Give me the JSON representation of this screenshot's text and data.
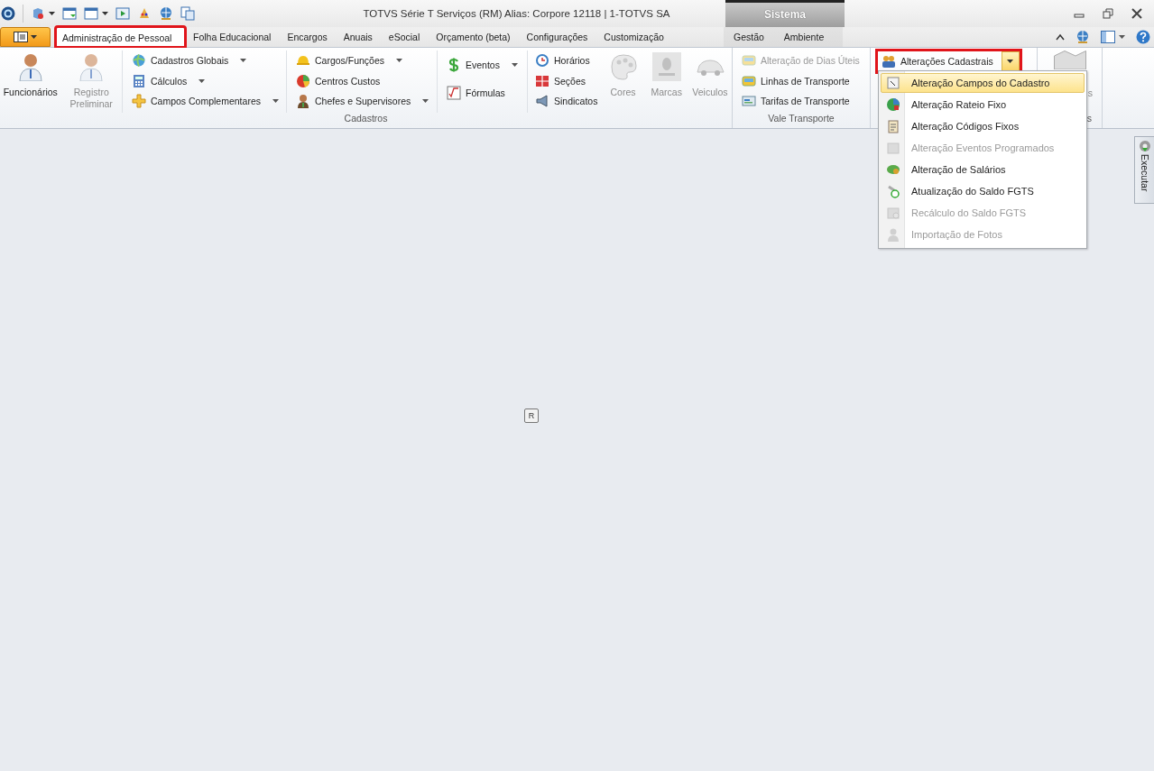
{
  "window": {
    "title": "TOTVS Série T Serviços (RM) Alias: Corpore 12118 | 1-TOTVS SA"
  },
  "context_group": {
    "title": "Sistema"
  },
  "tabs": [
    {
      "label": "Administração de Pessoal",
      "selected": true,
      "highlighted": true,
      "kind": "normal"
    },
    {
      "label": "Folha Educacional",
      "selected": false,
      "highlighted": false,
      "kind": "normal"
    },
    {
      "label": "Encargos",
      "selected": false,
      "highlighted": false,
      "kind": "normal"
    },
    {
      "label": "Anuais",
      "selected": false,
      "highlighted": false,
      "kind": "normal"
    },
    {
      "label": "eSocial",
      "selected": false,
      "highlighted": false,
      "kind": "normal"
    },
    {
      "label": "Orçamento (beta)",
      "selected": false,
      "highlighted": false,
      "kind": "normal"
    },
    {
      "label": "Configurações",
      "selected": false,
      "highlighted": false,
      "kind": "normal"
    },
    {
      "label": "Customização",
      "selected": false,
      "highlighted": false,
      "kind": "normal"
    },
    {
      "label": "Gestão",
      "selected": false,
      "highlighted": false,
      "kind": "context"
    },
    {
      "label": "Ambiente",
      "selected": false,
      "highlighted": false,
      "kind": "context"
    }
  ],
  "ribbon": {
    "groups": [
      {
        "label": "Cadastros",
        "sections": [
          {
            "kind": "large",
            "items": [
              {
                "label": "Funcionários",
                "disabled": false
              },
              {
                "label": "Registro Preliminar",
                "disabled": true
              }
            ]
          },
          {
            "kind": "stack",
            "items": [
              {
                "label": "Cadastros Globais",
                "dropdown": true,
                "disabled": false
              },
              {
                "label": "Cálculos",
                "dropdown": true,
                "disabled": false
              },
              {
                "label": "Campos Complementares",
                "dropdown": true,
                "disabled": false
              }
            ]
          },
          {
            "kind": "stack",
            "items": [
              {
                "label": "Cargos/Funções",
                "dropdown": true,
                "disabled": false
              },
              {
                "label": "Centros Custos",
                "dropdown": false,
                "disabled": false
              },
              {
                "label": "Chefes e Supervisores",
                "dropdown": true,
                "disabled": false
              }
            ]
          },
          {
            "kind": "stack2",
            "items": [
              {
                "label": "Eventos",
                "dropdown": true,
                "disabled": false
              },
              {
                "label": "Fórmulas",
                "dropdown": false,
                "disabled": false
              }
            ]
          },
          {
            "kind": "stack",
            "items": [
              {
                "label": "Horários",
                "dropdown": false,
                "disabled": false
              },
              {
                "label": "Seções",
                "dropdown": false,
                "disabled": false
              },
              {
                "label": "Sindicatos",
                "dropdown": false,
                "disabled": false
              }
            ]
          },
          {
            "kind": "large",
            "items": [
              {
                "label": "Cores",
                "disabled": true
              },
              {
                "label": "Marcas",
                "disabled": true
              },
              {
                "label": "Veiculos",
                "disabled": true
              }
            ]
          }
        ]
      },
      {
        "label": "Vale Transporte",
        "sections": [
          {
            "kind": "stack",
            "items": [
              {
                "label": "Alteração de Dias Úteis",
                "dropdown": false,
                "disabled": true
              },
              {
                "label": "Linhas de Transporte",
                "dropdown": false,
                "disabled": false
              },
              {
                "label": "Tarifas de Transporte",
                "dropdown": false,
                "disabled": false
              }
            ]
          }
        ]
      },
      {
        "sections": [
          {
            "kind": "split",
            "items": [
              {
                "label": "Alterações Cadastrais",
                "highlighted": true
              }
            ]
          }
        ]
      },
      {
        "label": "s",
        "sections": [
          {
            "kind": "clipped",
            "items": [
              {
                "label": "s"
              }
            ]
          }
        ]
      }
    ]
  },
  "menu": {
    "items": [
      {
        "label": "Alteração Campos do Cadastro",
        "selected": true,
        "disabled": false
      },
      {
        "label": "Alteração Rateio Fixo",
        "selected": false,
        "disabled": false
      },
      {
        "label": "Alteração Códigos Fixos",
        "selected": false,
        "disabled": false
      },
      {
        "label": "Alteração Eventos Programados",
        "selected": false,
        "disabled": true
      },
      {
        "label": "Alteração de Salários",
        "selected": false,
        "disabled": false
      },
      {
        "label": "Atualização do Saldo FGTS",
        "selected": false,
        "disabled": false
      },
      {
        "label": "Recálculo do Saldo FGTS",
        "selected": false,
        "disabled": true
      },
      {
        "label": "Importação de Fotos",
        "selected": false,
        "disabled": true
      }
    ]
  },
  "side_tab": {
    "label": "Executar"
  },
  "canvas": {
    "marker": "R"
  }
}
